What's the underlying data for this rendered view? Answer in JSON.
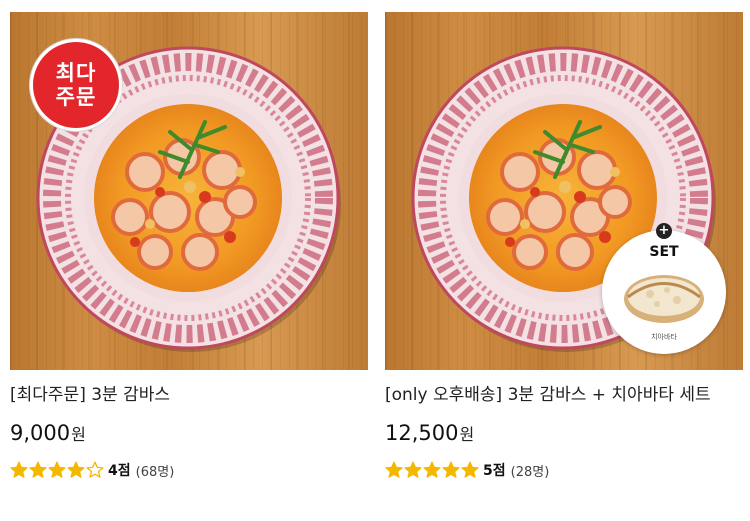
{
  "products": [
    {
      "badge": "최다주문",
      "title": "[최다주문] 3분 감바스",
      "price": "9,000",
      "currency": "원",
      "rating": 4,
      "rating_label": "4점",
      "review_count": "(68명)",
      "colors": {
        "badge": "#e2262c",
        "star": "#f5b800"
      }
    },
    {
      "title": "[only 오후배송] 3분 감바스 + 치아바타 세트",
      "set_badge": {
        "label": "SET",
        "plus": "+",
        "caption": "치아바타"
      },
      "price": "12,500",
      "currency": "원",
      "rating": 5,
      "rating_label": "5점",
      "review_count": "(28명)",
      "colors": {
        "star": "#f5b800"
      }
    }
  ]
}
